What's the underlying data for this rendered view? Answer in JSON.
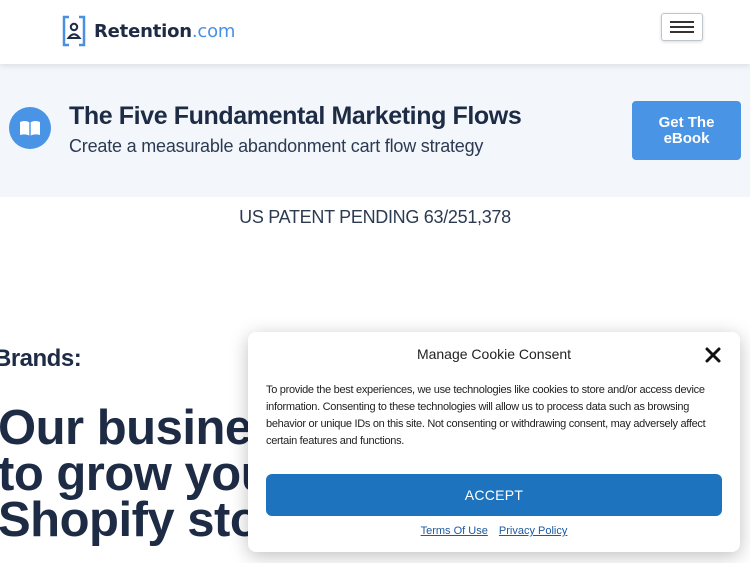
{
  "header": {
    "logo_strong": "Retention",
    "logo_light": ".com"
  },
  "banner": {
    "title": "The Five Fundamental Marketing Flows",
    "subtitle": "Create a measurable abandonment cart flow strategy",
    "cta_label_line1": "Get The",
    "cta_label_line2": "eBook"
  },
  "patent": "US PATENT PENDING 63/251,378",
  "main": {
    "brands_label": "Brands:",
    "hero_lines": [
      "Our business",
      "to grow your",
      "Shopify store"
    ]
  },
  "cookie": {
    "title": "Manage Cookie Consent",
    "body": "To provide the best experiences, we use technologies like cookies to store and/or access device information. Consenting to these technologies will allow us to process data such as browsing behavior or unique IDs on this site. Not consenting or withdrawing consent, may adversely affect certain features and functions.",
    "accept_label": "ACCEPT",
    "terms_link": "Terms Of Use",
    "privacy_link": "Privacy Policy"
  },
  "colors": {
    "brand_navy": "#1d2b45",
    "brand_blue": "#4a94e6",
    "accept_blue": "#1e73be",
    "banner_bg": "#f3f7fc"
  },
  "icons": [
    "retention-logo-icon",
    "hamburger-menu-icon",
    "open-book-icon",
    "close-icon"
  ]
}
